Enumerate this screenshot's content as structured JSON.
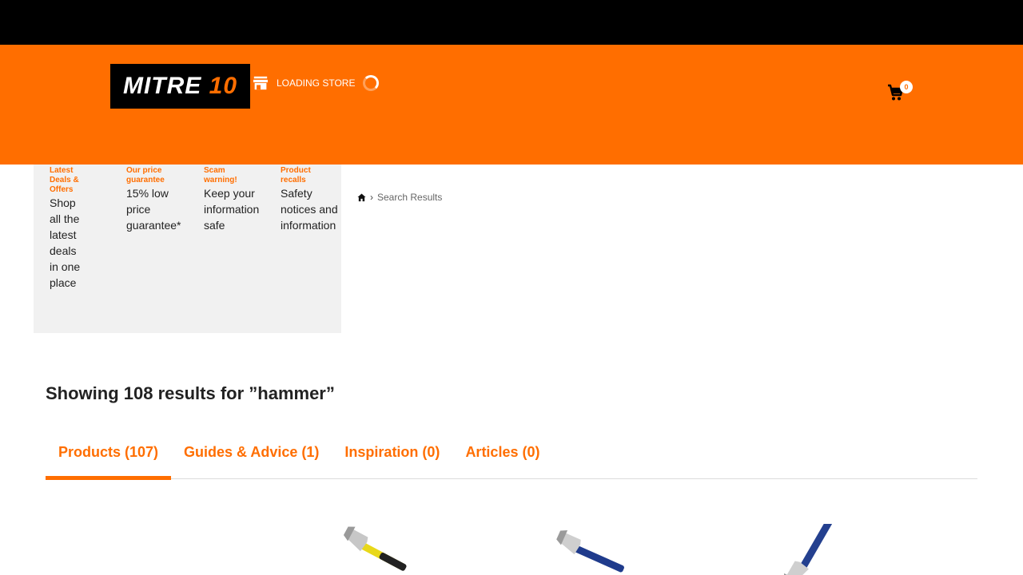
{
  "header": {
    "logo": {
      "main": "MITRE",
      "accent": "10"
    },
    "store": {
      "label": "LOADING STORE",
      "icon": "store-icon"
    },
    "cart": {
      "count": "0",
      "icon": "cart-icon"
    }
  },
  "promos": [
    {
      "title": "Latest Deals & Offers",
      "body": "Shop all the latest deals in one place"
    },
    {
      "title": "Our price guarantee",
      "body": "15% low price guarantee*"
    },
    {
      "title": "Scam warning!",
      "body": "Keep your information safe"
    },
    {
      "title": "Product recalls",
      "body": "Safety notices and information"
    }
  ],
  "breadcrumb": {
    "home_icon": "home-icon",
    "current": "Search Results"
  },
  "results": {
    "title": "Showing 108 results for ”hammer”"
  },
  "tabs": [
    {
      "label": "Products (107)",
      "active": true
    },
    {
      "label": "Guides & Advice (1)",
      "active": false
    },
    {
      "label": "Inspiration (0)",
      "active": false
    },
    {
      "label": "Articles (0)",
      "active": false
    }
  ],
  "colors": {
    "brand": "#ff6e00",
    "topbar": "#000000",
    "panel": "#f1f1f1"
  }
}
